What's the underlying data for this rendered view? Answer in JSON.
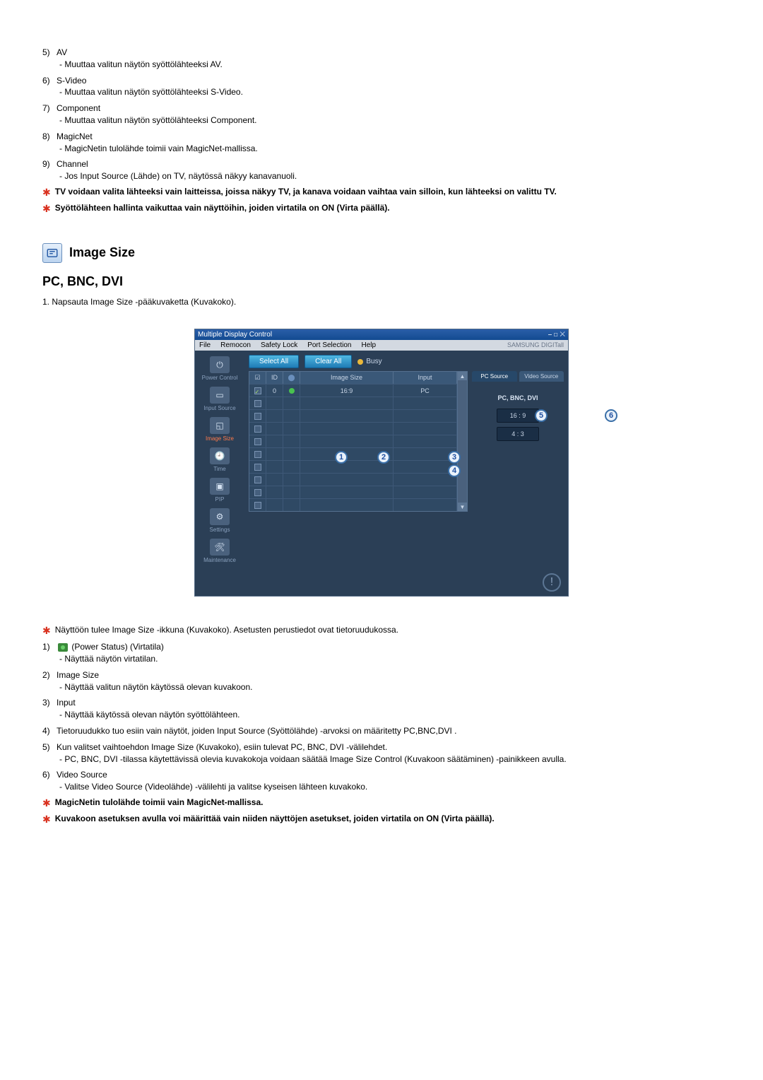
{
  "topList": [
    {
      "num": "5)",
      "title": "AV",
      "desc": "- Muuttaa valitun näytön syöttölähteeksi AV."
    },
    {
      "num": "6)",
      "title": "S-Video",
      "desc": "- Muuttaa valitun näytön syöttölähteeksi S-Video."
    },
    {
      "num": "7)",
      "title": "Component",
      "desc": "- Muuttaa valitun näytön syöttölähteeksi Component."
    },
    {
      "num": "8)",
      "title": "MagicNet",
      "desc": "- MagicNetin tulolähde toimii vain MagicNet-mallissa."
    },
    {
      "num": "9)",
      "title": "Channel",
      "desc": "- Jos Input Source (Lähde) on TV, näytössä näkyy kanavanuoli."
    }
  ],
  "topNotes": [
    "TV voidaan valita lähteeksi vain laitteissa, joissa näkyy TV, ja kanava voidaan vaihtaa vain silloin, kun lähteeksi on valittu TV.",
    "Syöttölähteen hallinta vaikuttaa vain näyttöihin, joiden virtatila on ON (Virta päällä)."
  ],
  "section": {
    "title": "Image Size"
  },
  "subtitle": "PC, BNC, DVI",
  "stepOne": "1.  Napsauta Image Size -pääkuvaketta (Kuvakoko).",
  "app": {
    "title": "Multiple Display Control",
    "winIcons": "⎯ ◻ ✕",
    "menu": [
      "File",
      "Remocon",
      "Safety Lock",
      "Port Selection",
      "Help"
    ],
    "brand": "SAMSUNG DIGITall",
    "sidebar": [
      {
        "label": "Power Control",
        "glyph": "⏻"
      },
      {
        "label": "Input Source",
        "glyph": "▭"
      },
      {
        "label": "Image Size",
        "glyph": "◱"
      },
      {
        "label": "Time",
        "glyph": "🕘"
      },
      {
        "label": "PIP",
        "glyph": "▣"
      },
      {
        "label": "Settings",
        "glyph": "⚙"
      },
      {
        "label": "Maintenance",
        "glyph": "🛠"
      }
    ],
    "toolbar": {
      "selectAll": "Select All",
      "clearAll": "Clear All",
      "busy": "Busy"
    },
    "gridHead": {
      "chk": "☑",
      "id": "ID",
      "ps": "⬤",
      "size": "Image Size",
      "input": "Input"
    },
    "rows": [
      {
        "chk": true,
        "id": "0",
        "ps": true,
        "size": "16:9",
        "input": "PC"
      },
      {
        "chk": false,
        "id": "",
        "ps": false,
        "size": "",
        "input": ""
      },
      {
        "chk": false,
        "id": "",
        "ps": false,
        "size": "",
        "input": ""
      },
      {
        "chk": false,
        "id": "",
        "ps": false,
        "size": "",
        "input": ""
      },
      {
        "chk": false,
        "id": "",
        "ps": false,
        "size": "",
        "input": ""
      },
      {
        "chk": false,
        "id": "",
        "ps": false,
        "size": "",
        "input": ""
      },
      {
        "chk": false,
        "id": "",
        "ps": false,
        "size": "",
        "input": ""
      },
      {
        "chk": false,
        "id": "",
        "ps": false,
        "size": "",
        "input": ""
      },
      {
        "chk": false,
        "id": "",
        "ps": false,
        "size": "",
        "input": ""
      },
      {
        "chk": false,
        "id": "",
        "ps": false,
        "size": "",
        "input": ""
      }
    ],
    "tabs": {
      "pc": "PC Source",
      "video": "Video Source"
    },
    "panel": {
      "label": "PC, BNC, DVI",
      "r1": "16 : 9",
      "r2": "4 : 3"
    },
    "badges": {
      "b1": "1",
      "b2": "2",
      "b3": "3",
      "b4": "4",
      "b5": "5",
      "b6": "6"
    }
  },
  "afterNote": "Näyttöön tulee Image Size -ikkuna (Kuvakoko). Asetusten perustiedot ovat tietoruudukossa.",
  "bottomList": [
    {
      "num": "1)",
      "prefix": "",
      "title": "(Power Status) (Virtatila)",
      "hasIcon": true,
      "desc": "- Näyttää näytön virtatilan."
    },
    {
      "num": "2)",
      "prefix": "",
      "title": "Image Size",
      "hasIcon": false,
      "desc": "- Näyttää valitun näytön käytössä olevan kuvakoon."
    },
    {
      "num": "3)",
      "prefix": "",
      "title": "Input",
      "hasIcon": false,
      "desc": "- Näyttää käytössä olevan näytön syöttölähteen."
    },
    {
      "num": "4)",
      "prefix": "",
      "title": "Tietoruudukko tuo esiin vain näytöt, joiden Input Source (Syöttölähde) -arvoksi on määritetty PC,BNC,DVI .",
      "hasIcon": false,
      "desc": ""
    },
    {
      "num": "5)",
      "prefix": "",
      "title": "Kun valitset vaihtoehdon Image Size (Kuvakoko), esiin tulevat PC, BNC, DVI -välilehdet.",
      "hasIcon": false,
      "desc": "- PC, BNC, DVI -tilassa käytettävissä olevia kuvakokoja voidaan säätää Image Size Control (Kuvakoon säätäminen) -painikkeen avulla."
    },
    {
      "num": "6)",
      "prefix": "",
      "title": "Video Source",
      "hasIcon": false,
      "desc": "- Valitse Video Source (Videolähde) -välilehti ja valitse kyseisen lähteen kuvakoko."
    }
  ],
  "bottomNotes": [
    "MagicNetin tulolähde toimii vain MagicNet-mallissa.",
    "Kuvakoon asetuksen avulla voi määrittää vain niiden näyttöjen asetukset, joiden virtatila on ON (Virta päällä)."
  ]
}
